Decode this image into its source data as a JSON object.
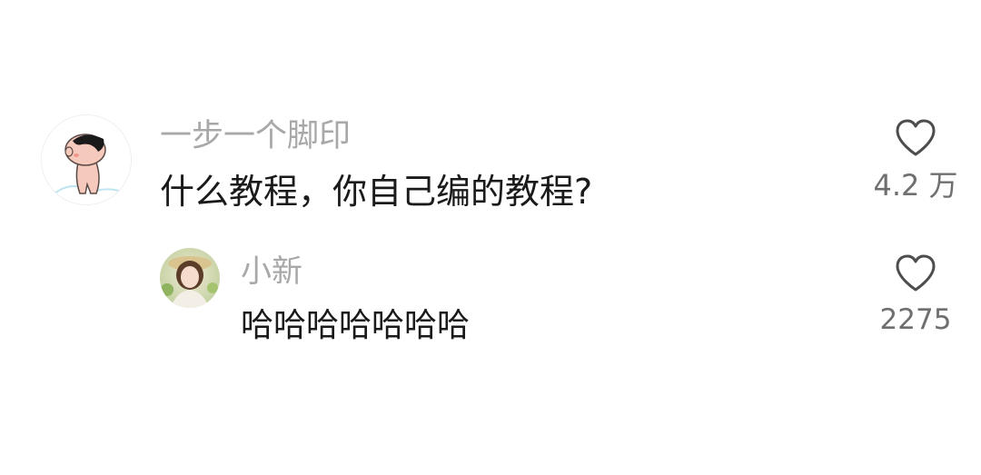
{
  "comments": [
    {
      "username": "一步一个脚印",
      "text": "什么教程，你自己编的教程?",
      "likes": "4.2 万",
      "like_icon": "heart-outline-icon",
      "avatar_icon": "cartoon-boy-avatar-icon"
    },
    {
      "username": "小新",
      "text": "哈哈哈哈哈哈哈",
      "likes": "2275",
      "like_icon": "heart-outline-icon",
      "avatar_icon": "girl-photo-avatar-icon"
    }
  ]
}
